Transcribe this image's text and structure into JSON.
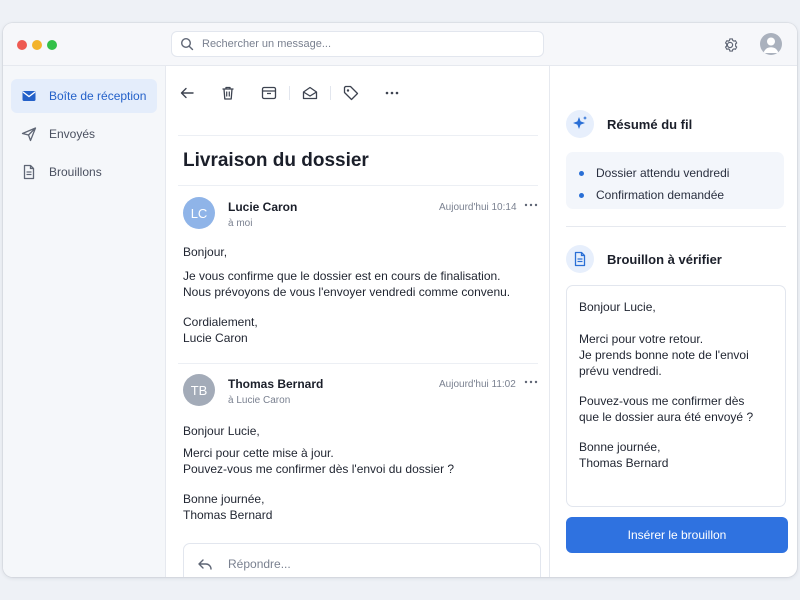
{
  "search": {
    "placeholder": "Rechercher un message..."
  },
  "sidebar": {
    "items": [
      {
        "label": "Boîte de réception",
        "icon": "inbox-icon",
        "active": true
      },
      {
        "label": "Envoyés",
        "icon": "send-icon",
        "active": false
      },
      {
        "label": "Brouillons",
        "icon": "draft-document-icon",
        "active": false
      }
    ]
  },
  "thread": {
    "subject": "Livraison du dossier",
    "messages": [
      {
        "initials": "LC",
        "avatar_color": "#8fb4e8",
        "sender": "Lucie Caron",
        "to": "à moi",
        "time": "Aujourd'hui 10:14",
        "body": [
          "Bonjour,",
          "Je vous confirme que le dossier est en cours de finalisation.",
          "Nous prévoyons de vous l'envoyer vendredi comme convenu.",
          "Cordialement,",
          "Lucie Caron"
        ]
      },
      {
        "initials": "TB",
        "avatar_color": "#a3abb8",
        "sender": "Thomas Bernard",
        "to": "à Lucie Caron",
        "time": "Aujourd'hui 11:02",
        "body": [
          "Bonjour Lucie,",
          "Merci pour cette mise à jour.",
          "Pouvez-vous me confirmer dès l'envoi du dossier ?",
          "Bonne journée,",
          "Thomas Bernard"
        ]
      }
    ],
    "reply_placeholder": "Répondre..."
  },
  "summary": {
    "title": "Résumé du fil",
    "items": [
      "Dossier attendu vendredi",
      "Confirmation demandée"
    ]
  },
  "draft": {
    "title": "Brouillon à vérifier",
    "lines": [
      "Bonjour Lucie,",
      "Merci pour votre retour.",
      "Je prends bonne note de l'envoi",
      "prévu vendredi.",
      "Pouvez-vous me confirmer dès",
      "que le dossier aura été envoyé ?",
      "Bonne journée,",
      "Thomas Bernard"
    ],
    "insert_label": "Insérer le brouillon"
  },
  "colors": {
    "accent": "#2f72e0",
    "active_nav_bg": "#e4edfb"
  }
}
